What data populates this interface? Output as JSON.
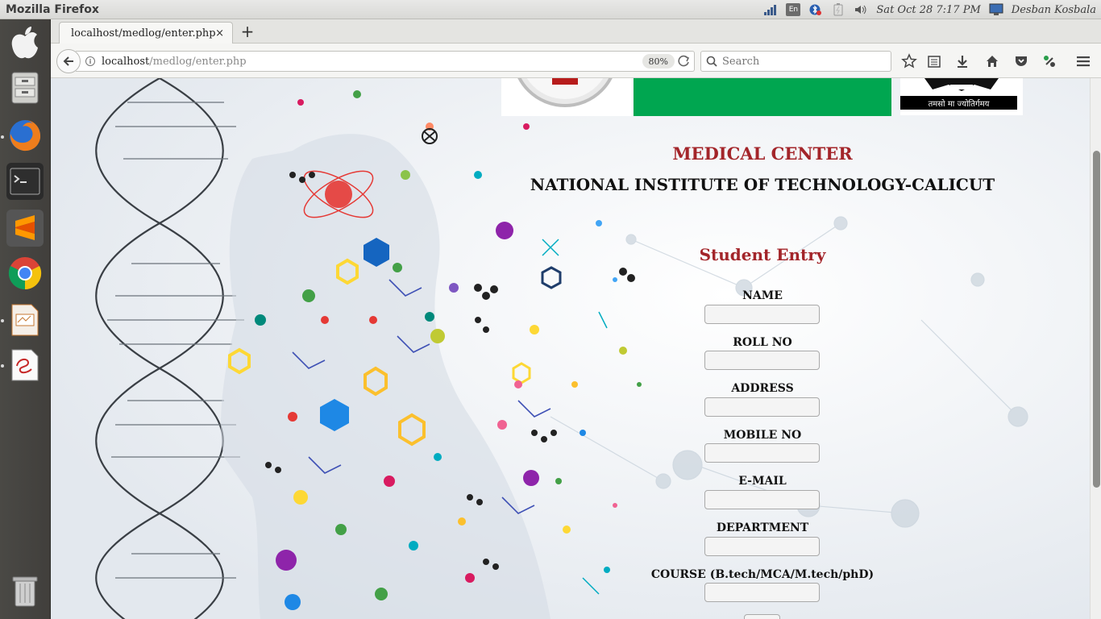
{
  "system_bar": {
    "app_title": "Mozilla Firefox",
    "keyboard_layout": "En",
    "datetime": "Sat Oct 28  7:17 PM",
    "user": "Desban Kosbala"
  },
  "launcher": {
    "items": [
      "finder-icon",
      "files-icon",
      "firefox-icon",
      "terminal-icon",
      "sublime-text-icon",
      "chrome-icon",
      "impress-icon",
      "document-viewer-icon",
      "trash-icon"
    ]
  },
  "browser": {
    "tab_title": "localhost/medlog/enter.php",
    "tab_close": "×",
    "new_tab": "+",
    "url_host": "localhost",
    "url_path": "/medlog/enter.php",
    "zoom": "80%",
    "search_placeholder": "Search"
  },
  "page": {
    "heading": "MEDICAL CENTER",
    "institute": "NATIONAL INSTITUTE OF TECHNOLOGY-CALICUT",
    "nit_motto": "तमसो मा ज्योतिर्गमय",
    "form_title": "Student Entry",
    "fields": [
      {
        "label": "NAME",
        "value": ""
      },
      {
        "label": "ROLL NO",
        "value": ""
      },
      {
        "label": "ADDRESS",
        "value": ""
      },
      {
        "label": "MOBILE NO",
        "value": ""
      },
      {
        "label": "E-MAIL",
        "value": ""
      },
      {
        "label": "DEPARTMENT",
        "value": ""
      },
      {
        "label": "COURSE (B.tech/MCA/M.tech/phD)",
        "value": ""
      }
    ]
  },
  "colors": {
    "accent_red": "#a3252a",
    "banner_green": "#00a650",
    "launcher_bg": "#43413e"
  }
}
